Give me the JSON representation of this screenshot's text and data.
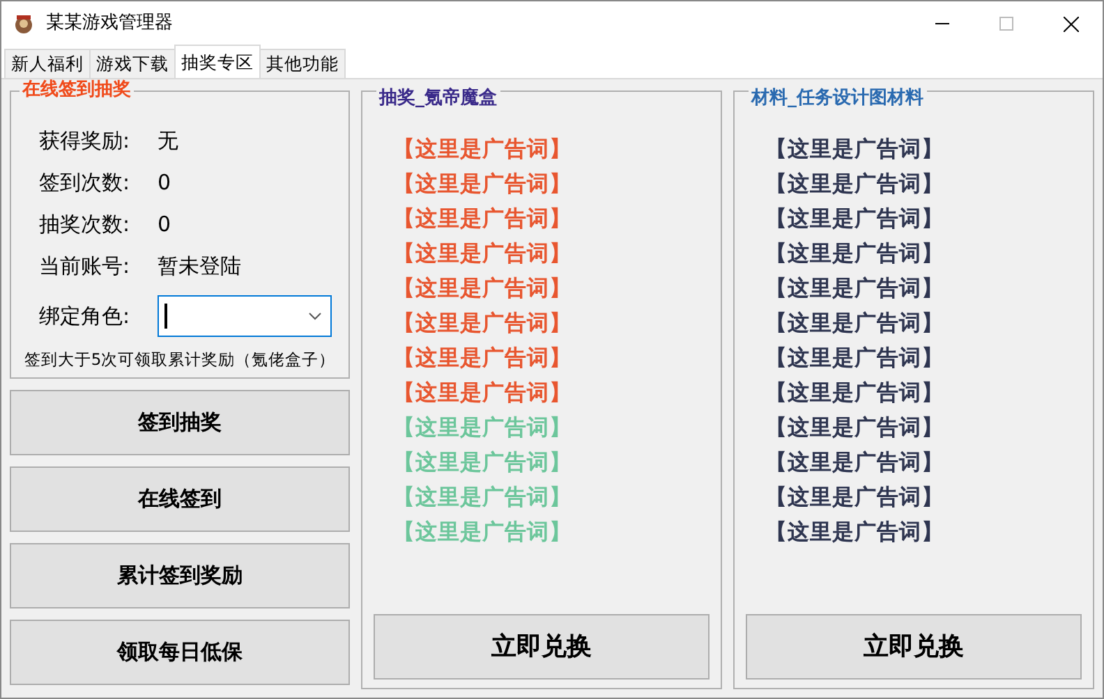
{
  "window": {
    "title": "某某游戏管理器"
  },
  "tabs": [
    {
      "label": "新人福利",
      "selected": false
    },
    {
      "label": "游戏下载",
      "selected": false
    },
    {
      "label": "抽奖专区",
      "selected": true
    },
    {
      "label": "其他功能",
      "selected": false
    }
  ],
  "signin_group": {
    "title": "在线签到抽奖",
    "fields": [
      {
        "label": "获得奖励:",
        "value": "无"
      },
      {
        "label": "签到次数:",
        "value": "0"
      },
      {
        "label": "抽奖次数:",
        "value": "0"
      },
      {
        "label": "当前账号:",
        "value": "暂未登陆"
      }
    ],
    "role": {
      "label": "绑定角色:"
    },
    "note": "签到大于5次可领取累计奖励（氪佬盒子）"
  },
  "buttons": [
    "签到抽奖",
    "在线签到",
    "累计签到奖励",
    "领取每日低保"
  ],
  "panels": [
    {
      "title": "抽奖_氪帝魔盒",
      "items": [
        {
          "text": "【这里是广告词】",
          "color": "#e8562f"
        },
        {
          "text": "【这里是广告词】",
          "color": "#e8562f"
        },
        {
          "text": "【这里是广告词】",
          "color": "#e8562f"
        },
        {
          "text": "【这里是广告词】",
          "color": "#e8562f"
        },
        {
          "text": "【这里是广告词】",
          "color": "#e8562f"
        },
        {
          "text": "【这里是广告词】",
          "color": "#e8562f"
        },
        {
          "text": "【这里是广告词】",
          "color": "#e8562f"
        },
        {
          "text": "【这里是广告词】",
          "color": "#e8562f"
        },
        {
          "text": "【这里是广告词】",
          "color": "#6cc69b"
        },
        {
          "text": "【这里是广告词】",
          "color": "#6cc69b"
        },
        {
          "text": "【这里是广告词】",
          "color": "#6cc69b"
        },
        {
          "text": "【这里是广告词】",
          "color": "#6cc69b"
        }
      ],
      "button": "立即兑换"
    },
    {
      "title": "材料_任务设计图材料",
      "items": [
        {
          "text": "【这里是广告词】",
          "color": "#2e3550"
        },
        {
          "text": "【这里是广告词】",
          "color": "#2e3550"
        },
        {
          "text": "【这里是广告词】",
          "color": "#2e3550"
        },
        {
          "text": "【这里是广告词】",
          "color": "#2e3550"
        },
        {
          "text": "【这里是广告词】",
          "color": "#2e3550"
        },
        {
          "text": "【这里是广告词】",
          "color": "#2e3550"
        },
        {
          "text": "【这里是广告词】",
          "color": "#2e3550"
        },
        {
          "text": "【这里是广告词】",
          "color": "#2e3550"
        },
        {
          "text": "【这里是广告词】",
          "color": "#2e3550"
        },
        {
          "text": "【这里是广告词】",
          "color": "#2e3550"
        },
        {
          "text": "【这里是广告词】",
          "color": "#2e3550"
        },
        {
          "text": "【这里是广告词】",
          "color": "#2e3550"
        }
      ],
      "button": "立即兑换"
    }
  ]
}
